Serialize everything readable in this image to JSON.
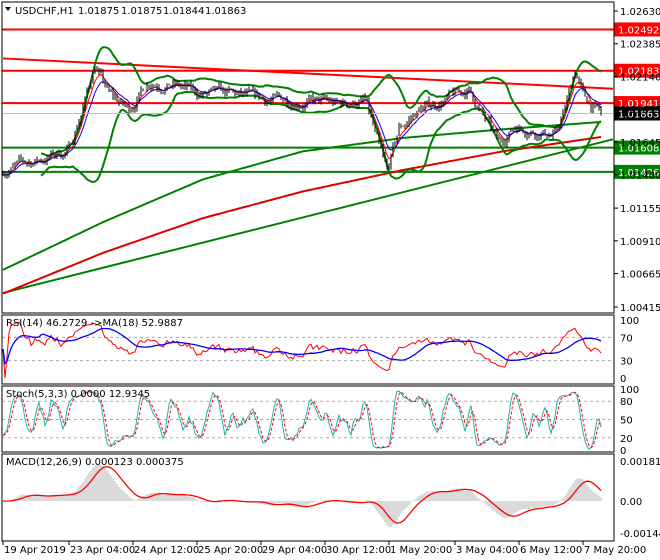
{
  "header": {
    "symbol": "USDCHF,H1",
    "open": "1.01875",
    "high": "1.01875",
    "low": "1.01844",
    "close": "1.01863"
  },
  "indicators": {
    "rsi_label": "RSI(14) 46.2729  ->MA(18) 52.9887",
    "stoch_label": "Stoch(5,3,3) 0.0000 12.9345",
    "macd_label": "MACD(12,26,9) 0.000123 0.000375"
  },
  "colors": {
    "resistance": "#ff0000",
    "support": "#008000",
    "rsi": "#ff0000",
    "rsi_ma": "#0000ff",
    "stoch_k": "#20b2aa",
    "stoch_d": "#ff0000",
    "macd_hist": "#b4b4b4",
    "macd_signal": "#ff0000"
  },
  "chart_data": {
    "type": "line",
    "title": "USDCHF,H1",
    "bars": 300,
    "close_keypoints": [
      [
        0,
        1.0144
      ],
      [
        18,
        1.01515
      ],
      [
        33,
        1.0159
      ],
      [
        41,
        1.01964
      ],
      [
        46,
        1.02226
      ],
      [
        53,
        1.02002
      ],
      [
        63,
        1.0189
      ],
      [
        73,
        1.02114
      ],
      [
        86,
        1.02077
      ],
      [
        98,
        1.02002
      ],
      [
        113,
        1.02002
      ],
      [
        128,
        1.01964
      ],
      [
        148,
        1.01964
      ],
      [
        168,
        1.01927
      ],
      [
        181,
        1.01964
      ],
      [
        188,
        1.0159
      ],
      [
        192,
        1.01403
      ],
      [
        198,
        1.0174
      ],
      [
        208,
        1.0189
      ],
      [
        221,
        1.01964
      ],
      [
        233,
        1.02039
      ],
      [
        241,
        1.01815
      ],
      [
        248,
        1.01628
      ],
      [
        256,
        1.01777
      ],
      [
        266,
        1.0174
      ],
      [
        276,
        1.01702
      ],
      [
        281,
        1.0189
      ],
      [
        286,
        1.02189
      ],
      [
        291,
        1.01964
      ],
      [
        299,
        1.01863
      ]
    ],
    "price_axis": {
      "ticks": [
        1.0263,
        1.02385,
        1.0214,
        1.01895,
        1.0165,
        1.01405,
        1.01155,
        1.0091,
        1.00665,
        1.00415
      ],
      "labels": [
        "1.02630",
        "1.02385",
        "1.02140",
        "1.01895",
        "1.01645",
        "1.01400",
        "1.01155",
        "1.00910",
        "1.00665",
        "1.00415"
      ],
      "range": [
        1.00415,
        1.0263
      ]
    },
    "levels": [
      {
        "price": 1.02492,
        "label": "1.02492",
        "kind": "resistance"
      },
      {
        "price": 1.02183,
        "label": "1.02183",
        "kind": "resistance"
      },
      {
        "price": 1.01941,
        "label": "1.01941",
        "kind": "resistance"
      },
      {
        "price": 1.01608,
        "label": "1.01608",
        "kind": "support"
      },
      {
        "price": 1.01426,
        "label": "1.01426",
        "kind": "support"
      }
    ],
    "current_price": {
      "price": 1.01863,
      "label": "1.01863"
    },
    "trendlines": [
      {
        "from": [
          0,
          1.02275
        ],
        "to": [
          305,
          1.02048
        ],
        "color": "#ff0000"
      },
      {
        "from": [
          0,
          1.0052
        ],
        "to": [
          305,
          1.0167
        ],
        "color": "#008000"
      }
    ],
    "ma_long_red": [
      [
        0,
        1.00515
      ],
      [
        50,
        1.0082
      ],
      [
        100,
        1.0108
      ],
      [
        150,
        1.0128
      ],
      [
        200,
        1.0144
      ],
      [
        250,
        1.0158
      ],
      [
        299,
        1.01687
      ]
    ],
    "ma_long_green": [
      [
        0,
        1.00693
      ],
      [
        50,
        1.0105
      ],
      [
        100,
        1.0137
      ],
      [
        150,
        1.0158
      ],
      [
        200,
        1.0168
      ],
      [
        250,
        1.01745
      ],
      [
        299,
        1.018
      ]
    ],
    "rsi_axis": [
      "100",
      "70",
      "30",
      "0"
    ],
    "stoch_axis": [
      "100",
      "80",
      "50",
      "20",
      "0"
    ],
    "macd_axis": [
      "0.001813",
      "0.00",
      "-0.001443"
    ],
    "time_labels": [
      {
        "bar": 0,
        "label": "19 Apr 2019"
      },
      {
        "bar": 33,
        "label": "23 Apr 04:00"
      },
      {
        "bar": 65,
        "label": "24 Apr 12:00"
      },
      {
        "bar": 97,
        "label": "25 Apr 20:00"
      },
      {
        "bar": 129,
        "label": "29 Apr 04:00"
      },
      {
        "bar": 161,
        "label": "30 Apr 12:00"
      },
      {
        "bar": 193,
        "label": "1 May 20:00"
      },
      {
        "bar": 226,
        "label": "3 May 04:00"
      },
      {
        "bar": 258,
        "label": "6 May 12:00"
      },
      {
        "bar": 290,
        "label": "7 May 20:00"
      }
    ]
  }
}
